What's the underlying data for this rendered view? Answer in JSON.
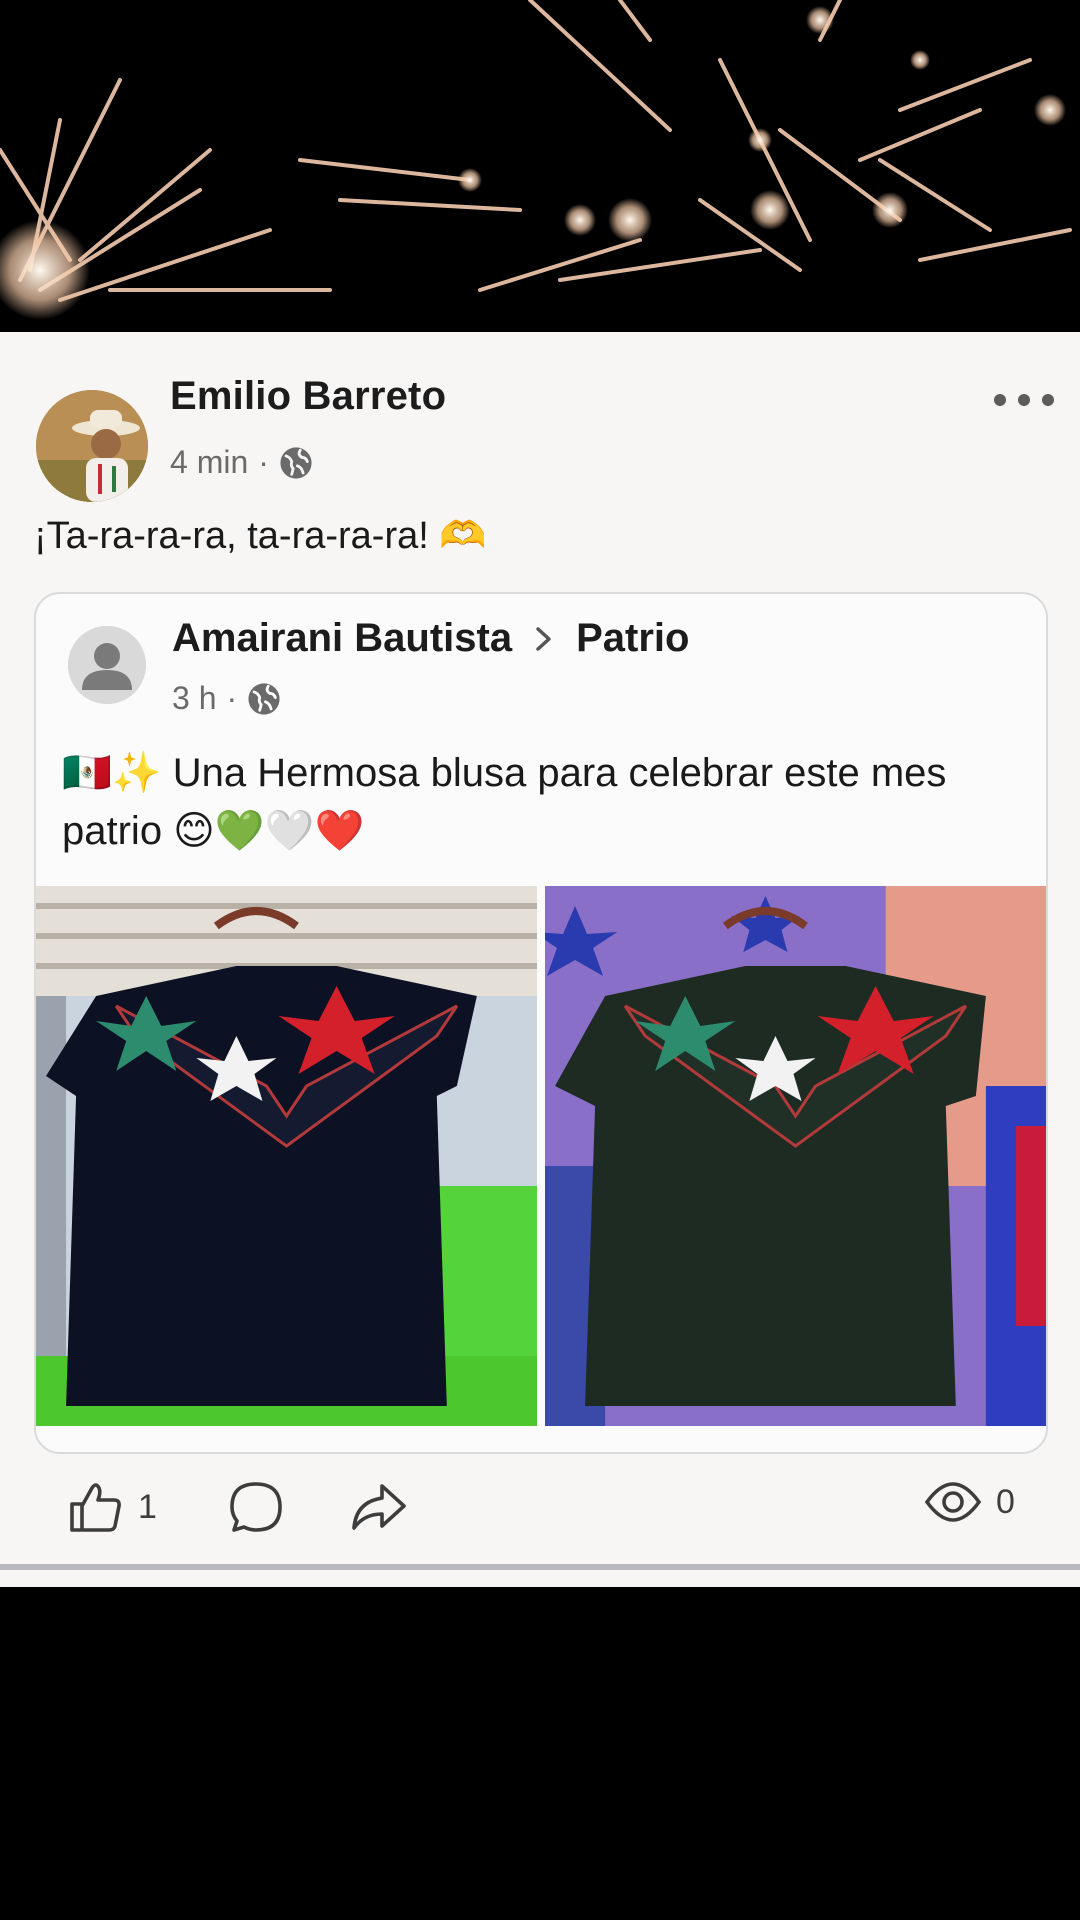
{
  "post": {
    "author": {
      "name": "Emilio Barreto",
      "time": "4 min",
      "separator": "·",
      "avatar_icon": "profile-photo-man-hat",
      "privacy_icon": "globe-icon"
    },
    "more_icon": "more-horizontal-icon",
    "text": "¡Ta-ra-ra-ra, ta-ra-ra-ra! 🫶",
    "shared_post": {
      "author": "Amairani Bautista",
      "group": "Patrio",
      "time": "3 h",
      "separator": "·",
      "privacy_icon": "globe-icon",
      "avatar_icon": "default-profile-icon",
      "text": "🇲🇽✨ Una Hermosa blusa para celebrar este mes patrio 😊💚🤍❤️",
      "photos": [
        {
          "description_icon": "embroidered-black-blouse-photo-1"
        },
        {
          "description_icon": "embroidered-black-blouse-photo-2"
        }
      ]
    },
    "actions": {
      "like_count": "1",
      "views_count": "0",
      "like_icon": "thumbs-up-icon",
      "comment_icon": "comment-icon",
      "share_icon": "share-arrow-icon",
      "views_icon": "eye-icon"
    }
  },
  "colors": {
    "card_bg": "#f7f6f5",
    "text_primary": "#1c1c1c",
    "text_secondary": "#6a6a6a",
    "divider": "#b9b9bf"
  }
}
